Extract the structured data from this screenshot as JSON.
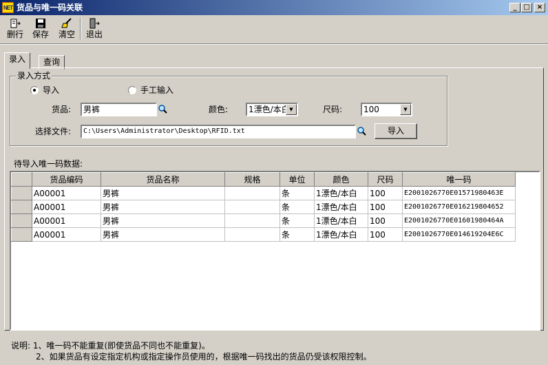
{
  "window": {
    "title": "货品与唯一码关联",
    "app_icon_text": "NET",
    "controls": {
      "minimize": "_",
      "maximize": "□",
      "close": "×"
    }
  },
  "toolbar": {
    "items": [
      {
        "label": "删行",
        "icon": "delete-row-icon"
      },
      {
        "label": "保存",
        "icon": "save-icon"
      },
      {
        "label": "清空",
        "icon": "broom-icon"
      },
      {
        "label": "退出",
        "icon": "exit-icon"
      }
    ]
  },
  "tabs": [
    {
      "label": "录入",
      "active": true
    },
    {
      "label": "查询",
      "active": false
    }
  ],
  "input_mode": {
    "legend": "录入方式",
    "option_import": "导入",
    "option_manual": "手工输入",
    "selected": "导入"
  },
  "form": {
    "product_label": "货品:",
    "product_value": "男裤",
    "color_label": "颜色:",
    "color_value": "1漂色/本白",
    "size_label": "尺码:",
    "size_value": "100",
    "file_label": "选择文件:",
    "file_value": "C:\\Users\\Administrator\\Desktop\\RFID.txt",
    "import_button": "导入"
  },
  "grid": {
    "label": "待导入唯一码数据:",
    "columns": [
      "货品编码",
      "货品名称",
      "规格",
      "单位",
      "颜色",
      "尺码",
      "唯一码"
    ],
    "rows": [
      [
        "A00001",
        "男裤",
        "",
        "条",
        "1漂色/本白",
        "100",
        "E2001026770E01571980463E"
      ],
      [
        "A00001",
        "男裤",
        "",
        "条",
        "1漂色/本白",
        "100",
        "E2001026770E016219804652"
      ],
      [
        "A00001",
        "男裤",
        "",
        "条",
        "1漂色/本白",
        "100",
        "E2001026770E01601980464A"
      ],
      [
        "A00001",
        "男裤",
        "",
        "条",
        "1漂色/本白",
        "100",
        "E2001026770E014619204E6C"
      ]
    ]
  },
  "notes": {
    "line1": "说明: 1、唯一码不能重复(即使货品不同也不能重复)。",
    "line2": "2、如果货品有设定指定机构或指定操作员使用的，根据唯一码找出的货品仍受该权限控制。"
  },
  "colors": {
    "title_start": "#0a246a",
    "title_end": "#a6caf0",
    "face": "#d4d0c8"
  }
}
